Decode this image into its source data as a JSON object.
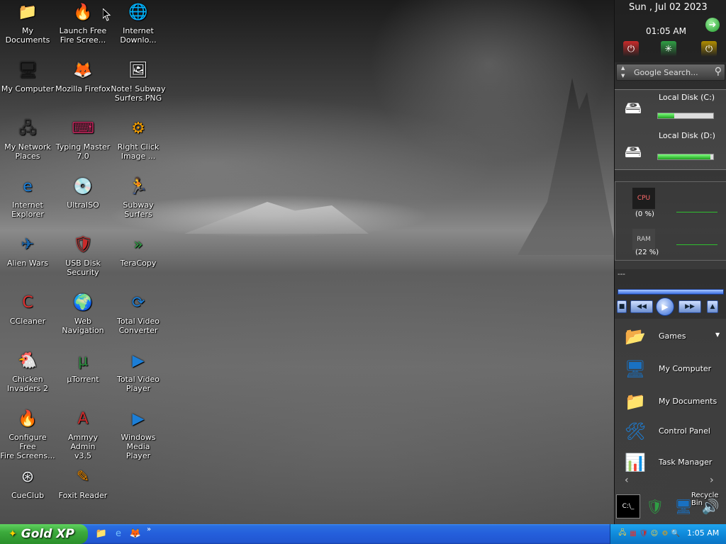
{
  "desktop": {
    "icons": [
      {
        "label": "My Documents",
        "glyph": "📁",
        "color": "#3b5fb0"
      },
      {
        "label": "Launch Free\nFire Scree...",
        "glyph": "🔥",
        "color": "#d9480f"
      },
      {
        "label": "Internet\nDownlo...",
        "glyph": "🌐",
        "color": "#2b9348"
      },
      {
        "label": "My Computer",
        "glyph": "🖥",
        "color": "#222222"
      },
      {
        "label": "Mozilla Firefox",
        "glyph": "🦊",
        "color": "#e8590c"
      },
      {
        "label": "Note! Subway\nSurfers.PNG",
        "glyph": "🖼",
        "color": "#ffffff"
      },
      {
        "label": "My Network\nPlaces",
        "glyph": "🖧",
        "color": "#333333"
      },
      {
        "label": "Typing Master\n7.0",
        "glyph": "⌨",
        "color": "#c2255c"
      },
      {
        "label": "Right Click\nImage ...",
        "glyph": "⚙",
        "color": "#f59f00"
      },
      {
        "label": "Internet\nExplorer",
        "glyph": "e",
        "color": "#1c7ed6"
      },
      {
        "label": "UltraISO",
        "glyph": "💿",
        "color": "#868e96"
      },
      {
        "label": "Subway\nSurfers",
        "glyph": "🏃",
        "color": "#e67700"
      },
      {
        "label": "Alien Wars",
        "glyph": "✈",
        "color": "#1864ab"
      },
      {
        "label": "USB Disk\nSecurity",
        "glyph": "🛡",
        "color": "#c92a2a"
      },
      {
        "label": "TeraCopy",
        "glyph": "»",
        "color": "#2f9e44"
      },
      {
        "label": "CCleaner",
        "glyph": "C",
        "color": "#e03131"
      },
      {
        "label": "Web\nNavigation",
        "glyph": "🌍",
        "color": "#1971c2"
      },
      {
        "label": "Total Video\nConverter",
        "glyph": "⟳",
        "color": "#1c7ed6"
      },
      {
        "label": "Chicken\nInvaders 2",
        "glyph": "🐔",
        "color": "#c92a2a"
      },
      {
        "label": "µTorrent",
        "glyph": "µ",
        "color": "#2b8a3e"
      },
      {
        "label": "Total Video\nPlayer",
        "glyph": "▶",
        "color": "#1c7ed6"
      },
      {
        "label": "Configure Free\nFire Screens...",
        "glyph": "🔥",
        "color": "#d9480f"
      },
      {
        "label": "Ammyy Admin\nv3.5",
        "glyph": "A",
        "color": "#c92a2a"
      },
      {
        "label": "Windows Media\nPlayer",
        "glyph": "▶",
        "color": "#1c7ed6"
      },
      {
        "label": "CueClub",
        "glyph": "⊛",
        "color": "#f1f3f5"
      },
      {
        "label": "Foxit Reader",
        "glyph": "✎",
        "color": "#f08c00"
      }
    ]
  },
  "sidebar": {
    "date": "Sun , Jul 02 2023",
    "time": "01:05 AM",
    "go_glyph": "➜",
    "buttons": [
      {
        "glyph": "⏻",
        "color": "#c92a2a"
      },
      {
        "glyph": "✳",
        "color": "#2f9e44"
      },
      {
        "glyph": "⏻",
        "color": "#b08d00"
      }
    ],
    "search_placeholder": "Google Search...",
    "search_icon": "magnifier-icon",
    "disks": [
      {
        "label": "Local Disk (C:)",
        "fill": 0.3
      },
      {
        "label": "Local Disk (D:)",
        "fill": 0.95
      }
    ],
    "cpu": {
      "label": "(0 %)",
      "icon": "CPU"
    },
    "ram": {
      "label": "(22 %)",
      "icon": "RAM"
    },
    "player": {
      "title": "---",
      "prev": "◀◀",
      "play": "▶",
      "next": "▶▶",
      "stop": "■",
      "eject": "▲"
    },
    "launcher": [
      {
        "label": "Games",
        "glyph": "📂",
        "color": "#4c6ef5"
      },
      {
        "label": "My Computer",
        "glyph": "🖥",
        "color": "#1971c2"
      },
      {
        "label": "My Documents",
        "glyph": "📁",
        "color": "#f59f00"
      },
      {
        "label": "Control Panel",
        "glyph": "🛠",
        "color": "#1c7ed6"
      },
      {
        "label": "Task Manager",
        "glyph": "📊",
        "color": "#2f9e44"
      }
    ],
    "dock": {
      "recycle_label": "Recycle Bin",
      "items": [
        {
          "glyph": "C:\\_",
          "color": "#000000"
        },
        {
          "glyph": "🛡",
          "color": "#2f9e44"
        },
        {
          "glyph": "🖥",
          "color": "#1971c2"
        },
        {
          "glyph": "🔊",
          "color": "#dee2e6"
        }
      ]
    }
  },
  "taskbar": {
    "start_label": "Gold XP",
    "quick_launch": [
      {
        "glyph": "📁",
        "color": "#f59f00"
      },
      {
        "glyph": "e",
        "color": "#74c0fc"
      },
      {
        "glyph": "🦊",
        "color": "#e8590c"
      }
    ],
    "more": "»",
    "tray_icons": [
      {
        "glyph": "🖧",
        "color": "#ffd43b"
      },
      {
        "glyph": "▦",
        "color": "#e03131"
      },
      {
        "glyph": "🛡",
        "color": "#c92a2a"
      },
      {
        "glyph": "☺",
        "color": "#ffd43b"
      },
      {
        "glyph": "⚙",
        "color": "#f59f00"
      },
      {
        "glyph": "🔍",
        "color": "#ffd43b"
      }
    ],
    "clock": "1:05 AM"
  }
}
